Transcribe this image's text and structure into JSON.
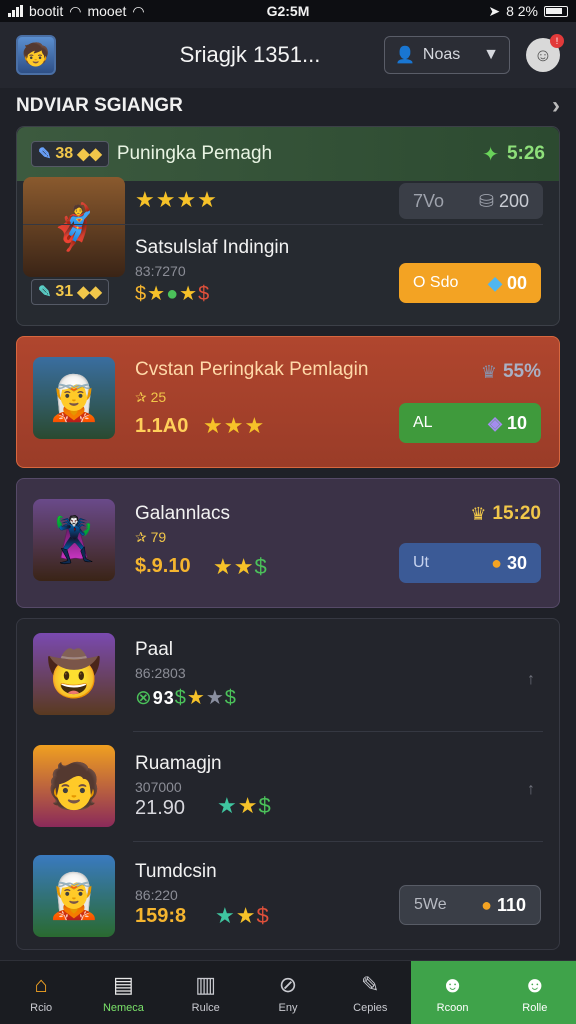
{
  "status": {
    "carrier": "bootit",
    "carrier2": "mooet",
    "time": "G2:5M",
    "battery": "8 2%"
  },
  "header": {
    "title": "Sriagjk 1351...",
    "dropdown": "Noas",
    "notif": "!"
  },
  "section": {
    "title": "NDVIAR SGIANGR"
  },
  "card1": {
    "badge_num": "38",
    "title": "Puningka Pemagh",
    "pct": "5:26",
    "stat_left": "7Vo",
    "stat_right": "200",
    "name": "Satsulslaf Indingin",
    "sub": "83:7270",
    "badge2": "31",
    "btn_left": "O Sdo",
    "btn_right": "00"
  },
  "card2": {
    "title": "Cvstan Peringkak Pemlagin",
    "sub": "✰ 25",
    "val": "1.1A0",
    "pct": "55%",
    "btn_left": "AL",
    "btn_right": "10"
  },
  "card3": {
    "title": "Galannlacs",
    "sub": "✰ 79",
    "val": "$.9.10",
    "pct": "15:20",
    "btn_left": "Ut",
    "btn_right": "30"
  },
  "list": [
    {
      "name": "Paal",
      "sub": "86:2803",
      "val": "93"
    },
    {
      "name": "Ruamagjn",
      "sub": "307000",
      "val": "21.90"
    },
    {
      "name": "Tumdcsin",
      "sub": "86:220",
      "val": "159:8",
      "btn_left": "5We",
      "btn_right": "110"
    }
  ],
  "tabs": [
    {
      "label": "Rcio",
      "icon": "home-icon"
    },
    {
      "label": "Nemeca",
      "icon": "doc-icon"
    },
    {
      "label": "Rulce",
      "icon": "book-icon"
    },
    {
      "label": "Eny",
      "icon": "shield-icon"
    },
    {
      "label": "Cepies",
      "icon": "pen-icon"
    },
    {
      "label": "Rcoon",
      "icon": "user-icon"
    },
    {
      "label": "Rolle",
      "icon": "user2-icon"
    }
  ],
  "colors": {
    "green": "#3fa34a",
    "orange": "#f3a323",
    "red_card": "#b0462e",
    "purple_card": "#3b3247"
  }
}
